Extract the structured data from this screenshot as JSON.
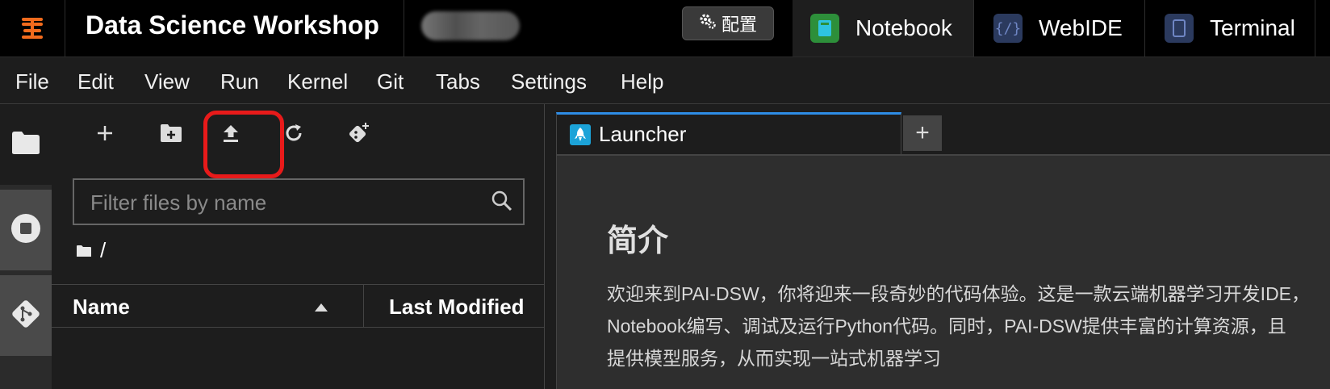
{
  "topbar": {
    "logo_icon": "pai-logo-icon",
    "app_title": "Data Science Workshop",
    "config_label": "配置",
    "tabs": [
      {
        "label": "Notebook",
        "icon": "notebook-icon",
        "active": true
      },
      {
        "label": "WebIDE",
        "icon": "code-icon",
        "active": false
      },
      {
        "label": "Terminal",
        "icon": "terminal-icon",
        "active": false
      }
    ]
  },
  "menubar": {
    "items": [
      {
        "label": "File"
      },
      {
        "label": "Edit"
      },
      {
        "label": "View"
      },
      {
        "label": "Run"
      },
      {
        "label": "Kernel"
      },
      {
        "label": "Git"
      },
      {
        "label": "Tabs"
      },
      {
        "label": "Settings"
      },
      {
        "label": "Help"
      }
    ]
  },
  "activity_bar": {
    "items": [
      "folder-icon",
      "stop-circle-icon",
      "git-icon"
    ]
  },
  "filebrowser": {
    "toolbar": [
      "new-launcher-icon",
      "new-folder-icon",
      "upload-icon",
      "refresh-icon",
      "git-clone-icon"
    ],
    "filter_placeholder": "Filter files by name",
    "breadcrumb": "/",
    "columns": {
      "name": "Name",
      "modified": "Last Modified"
    },
    "highlight_color": "#e81a1a"
  },
  "main": {
    "tab_label": "Launcher",
    "add_tab_label": "+",
    "intro_title": "简介",
    "intro_lines": [
      "欢迎来到PAI-DSW，你将迎来一段奇妙的代码体验。这是一款云端机器学习开发IDE，",
      "Notebook编写、调试及运行Python代码。同时，PAI-DSW提供丰富的计算资源，且",
      "提供模型服务，从而实现一站式机器学习"
    ]
  },
  "colors": {
    "accent_blue": "#2e8de6",
    "logo_orange": "#f26b1d",
    "background": "#1d1d1d"
  }
}
